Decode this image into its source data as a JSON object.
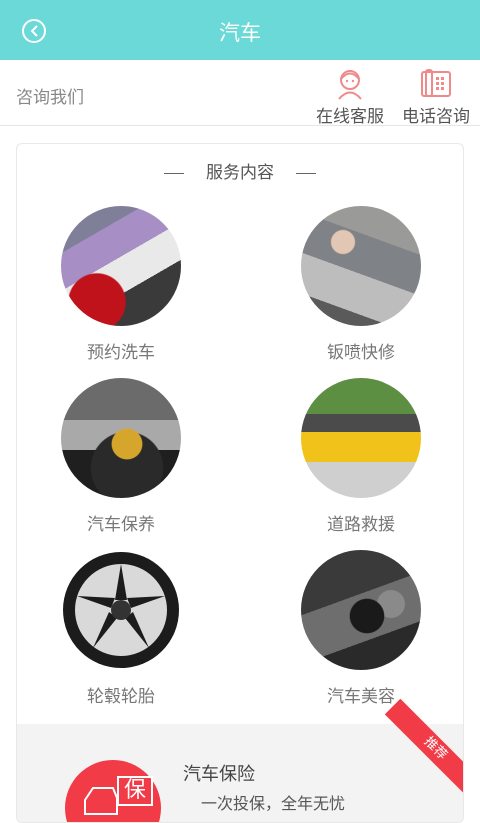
{
  "header": {
    "title": "汽车",
    "back_icon": "back-circle-icon"
  },
  "consult": {
    "label": "咨询我们",
    "online": {
      "label": "在线客服",
      "icon": "customer-service-icon"
    },
    "phone": {
      "label": "电话咨询",
      "icon": "telephone-icon"
    }
  },
  "services": {
    "heading": "服务内容",
    "items": [
      {
        "label": "预约洗车",
        "icon": "car-wash-photo"
      },
      {
        "label": "钣喷快修",
        "icon": "car-repair-photo"
      },
      {
        "label": "汽车保养",
        "icon": "oil-change-photo"
      },
      {
        "label": "道路救援",
        "icon": "tow-truck-photo"
      },
      {
        "label": "轮毂轮胎",
        "icon": "wheel-rim-photo"
      },
      {
        "label": "汽车美容",
        "icon": "car-polish-photo"
      }
    ]
  },
  "insurance": {
    "badge": "推荐",
    "title": "汽车保险",
    "subtitle": "一次投保，全年无忧",
    "icon_char": "保"
  },
  "colors": {
    "accent": "#6ad9d7",
    "brand_red": "#f13b47"
  }
}
